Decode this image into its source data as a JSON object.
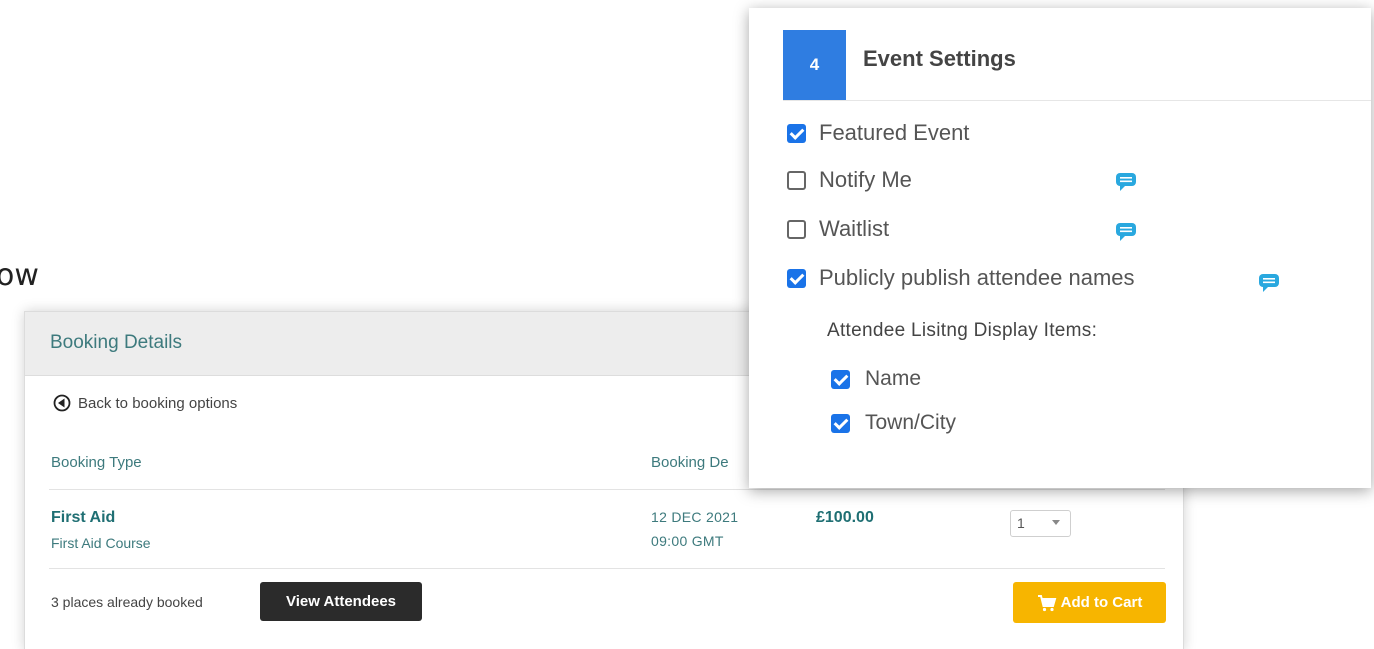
{
  "cut_text": "ow",
  "booking": {
    "title": "Booking Details",
    "back_label": "Back to booking options",
    "col_type": "Booking Type",
    "col_date": "Booking De",
    "item": {
      "name": "First Aid",
      "subtitle": "First Aid Course",
      "date_line1": "12 DEC 2021",
      "date_line2": "09:00 GMT",
      "price": "£100.00",
      "quantity": "1"
    },
    "places_text": "3 places already booked",
    "view_attendees_label": "View Attendees",
    "add_to_cart_label": "Add to Cart"
  },
  "settings": {
    "step_number": "4",
    "title": "Event Settings",
    "options": [
      {
        "label": "Featured Event",
        "checked": true
      },
      {
        "label": "Notify Me",
        "checked": false
      },
      {
        "label": "Waitlist",
        "checked": false
      },
      {
        "label": "Publicly publish attendee names",
        "checked": true
      }
    ],
    "display_items_heading": "Attendee Lisitng Display Items:",
    "display_items": [
      {
        "label": "Name",
        "checked": true
      },
      {
        "label": "Town/City",
        "checked": true
      }
    ]
  },
  "colors": {
    "accent_blue": "#2f7de1",
    "checkbox_blue": "#1a73e8",
    "teal_text": "#3d7a7d",
    "cart_yellow": "#f7b500",
    "chat_icon": "#29a8df"
  },
  "icons": [
    "back-arrow-icon",
    "cart-icon",
    "chat-bubble-icon",
    "dropdown-caret-icon"
  ]
}
